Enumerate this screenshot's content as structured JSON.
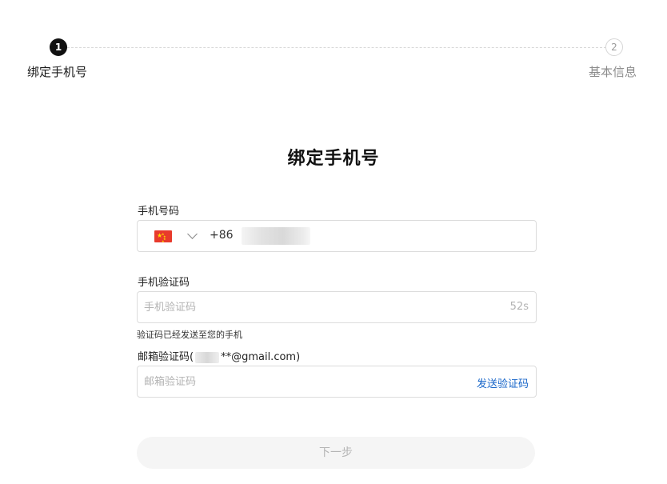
{
  "steps": [
    {
      "number": "1",
      "label": "绑定手机号",
      "active": true
    },
    {
      "number": "2",
      "label": "基本信息",
      "active": false
    }
  ],
  "title": "绑定手机号",
  "phone": {
    "label": "手机号码",
    "country_flag": "china-flag-icon",
    "dial_code": "+86"
  },
  "sms_code": {
    "label": "手机验证码",
    "placeholder": "手机验证码",
    "countdown": "52s",
    "hint": "验证码已经发送至您的手机"
  },
  "email_code": {
    "label_prefix": "邮箱验证码(",
    "label_suffix": "**@gmail.com)",
    "placeholder": "邮箱验证码",
    "send_label": "发送验证码"
  },
  "next_button": "下一步",
  "colors": {
    "link": "#1866c9",
    "active_step": "#111111",
    "disabled_text": "#b5b5b5"
  }
}
